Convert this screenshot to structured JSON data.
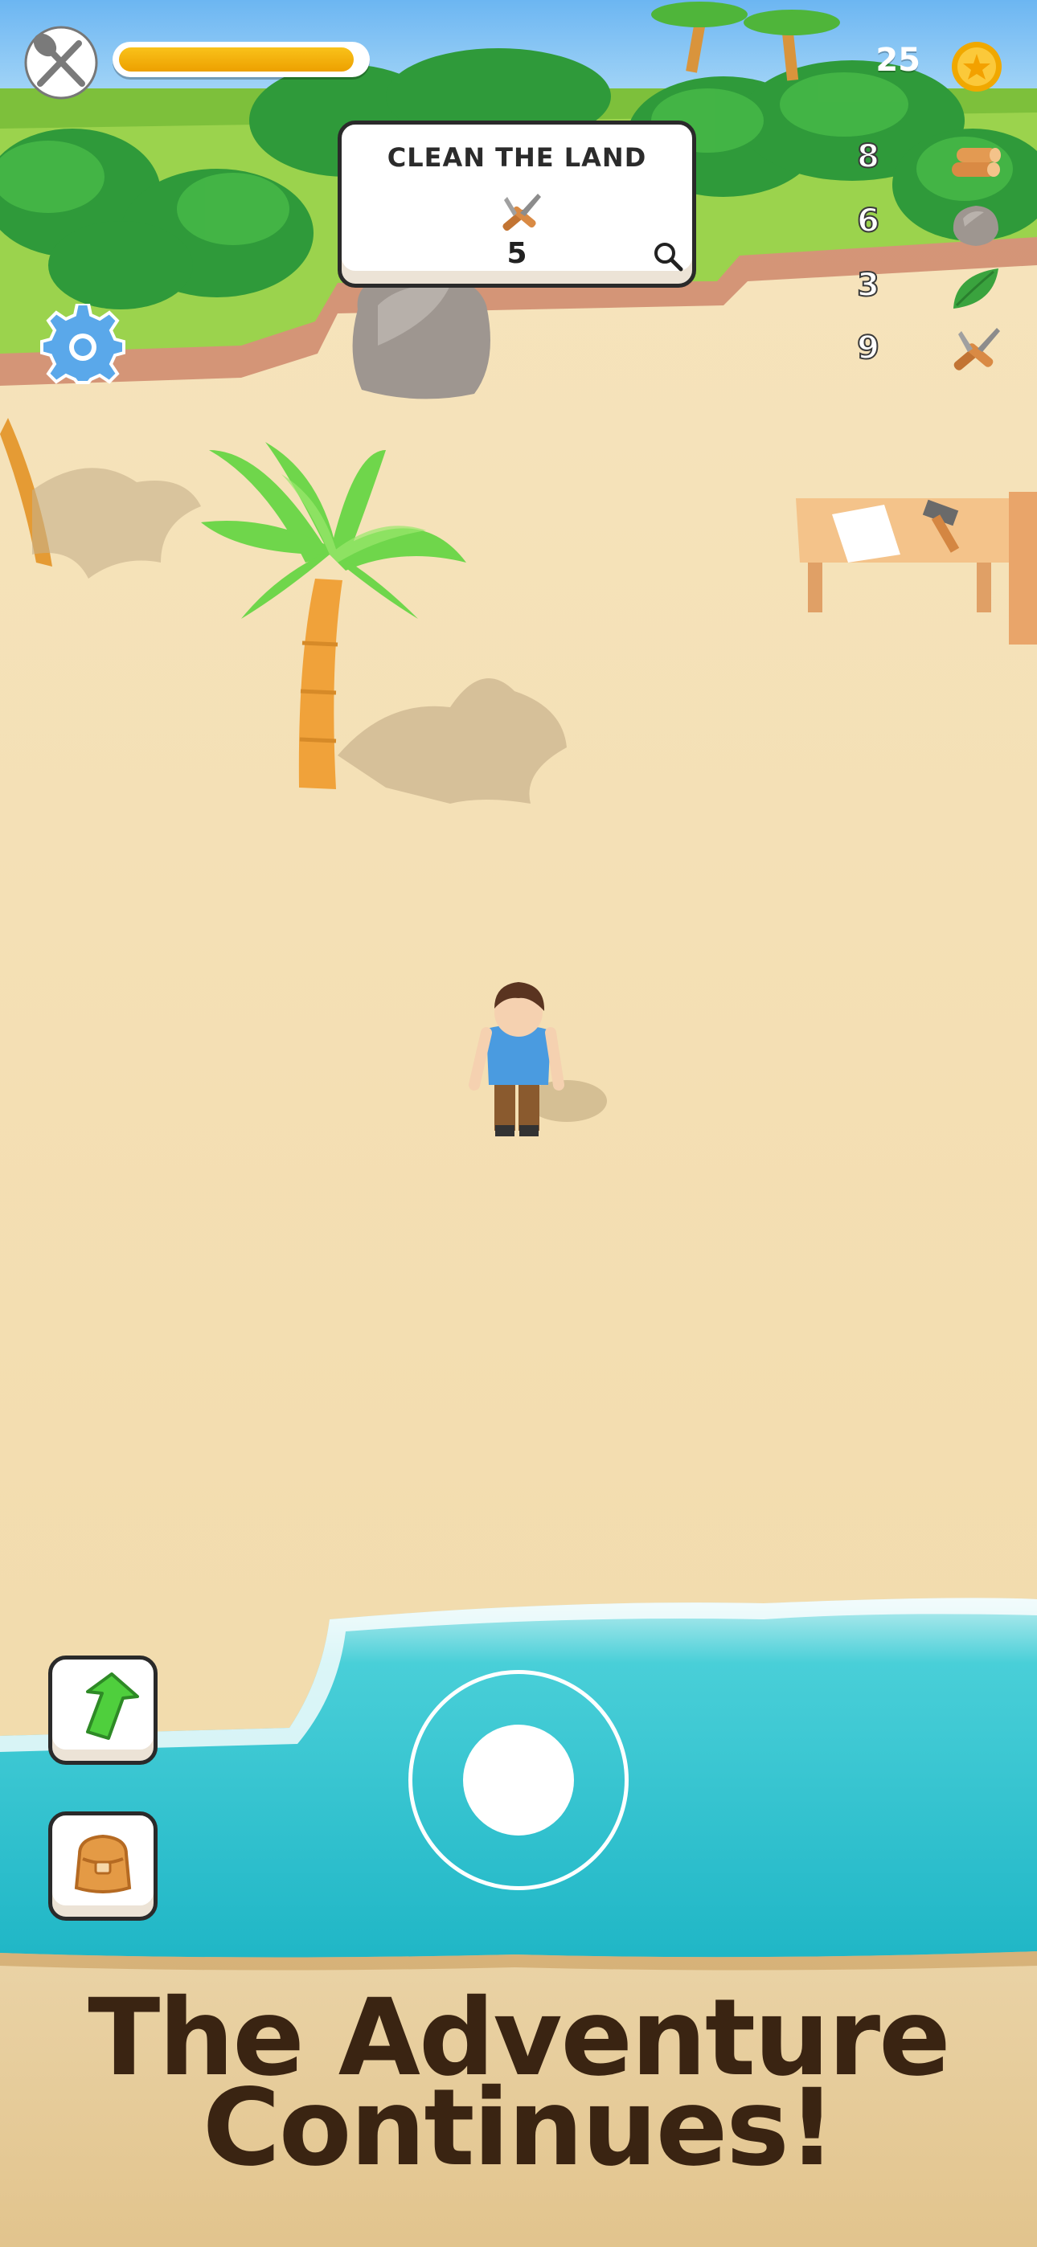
{
  "hud": {
    "hunger_icon": "fork-spoon-icon",
    "hunger_level": 0.96,
    "coins": "25",
    "coin_icon": "star-coin-icon",
    "settings_icon": "gear-icon"
  },
  "quest": {
    "title": "CLEAN THE LAND",
    "tool_icon": "shears-icon",
    "count": "5",
    "search_icon": "magnifier-icon"
  },
  "resources": [
    {
      "count": "8",
      "icon": "wood-logs-icon"
    },
    {
      "count": "6",
      "icon": "stone-icon"
    },
    {
      "count": "3",
      "icon": "leaf-icon"
    },
    {
      "count": "9",
      "icon": "shears-icon"
    }
  ],
  "buttons": {
    "upgrade_icon": "up-arrow-icon",
    "inventory_icon": "backpack-icon"
  },
  "banner": {
    "line1": "The Adventure",
    "line2": "Continues!"
  },
  "colors": {
    "sand": "#f3dfb4",
    "sea": "#2fc6d2",
    "grass": "#9ad24a",
    "banner_text": "#3a2412",
    "hunger_fill": "#f5b10d"
  }
}
